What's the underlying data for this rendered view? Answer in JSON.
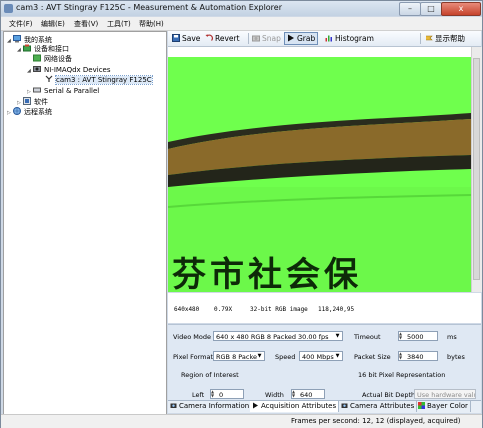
{
  "window": {
    "title": "cam3 : AVT Stingray F125C - Measurement & Automation Explorer",
    "minimize": "–",
    "maximize": "□",
    "close": "x"
  },
  "menubar": [
    "文件(F)",
    "编辑(E)",
    "查看(V)",
    "工具(T)",
    "帮助(H)"
  ],
  "tree": {
    "root": "我的系统",
    "devices_interfaces": "设备和接口",
    "network_devices": "网络设备",
    "imaqdx": "NI-IMAQdx Devices",
    "camera": "cam3 : AVT Stingray F125C",
    "serial": "Serial & Parallel",
    "software": "软件",
    "remote": "远程系统"
  },
  "toolbar": {
    "save": "Save",
    "revert": "Revert",
    "snap": "Snap",
    "grab": "Grab",
    "histogram": "Histogram",
    "help": "显示帮助"
  },
  "image_overlay_text": "芬市社会保",
  "image_info": {
    "resolution": "640x480",
    "zoom": "0.79X",
    "format": "32-bit RGB image",
    "pixel": "118,240,95"
  },
  "attributes": {
    "video_mode_label": "Video Mode",
    "video_mode_value": "640 x 480 RGB 8 Packed 30.00 fps",
    "timeout_label": "Timeout",
    "timeout_value": "5000",
    "timeout_unit": "ms",
    "pixel_format_label": "Pixel Format",
    "pixel_format_value": "RGB 8 Packe",
    "speed_label": "Speed",
    "speed_value": "400 Mbps",
    "packet_size_label": "Packet Size",
    "packet_size_value": "3840",
    "packet_size_unit": "bytes",
    "roi_label": "Region of Interest",
    "bit_repr_label": "16 bit Pixel Representation",
    "left_label": "Left",
    "left_value": "0",
    "width_label": "Width",
    "width_value": "640",
    "actual_bit_depth_label": "Actual Bit Depth",
    "actual_bit_depth_value": "Use hardware value"
  },
  "tabs": [
    "Camera Information",
    "Acquisition Attributes",
    "Camera Attributes",
    "Bayer Color"
  ],
  "status": "Frames per second: 12, 12 (displayed, acquired)",
  "colors": {
    "image_green": "#6fff4d",
    "band_dark": "#2b2a1a",
    "band_brown": "#8a6a2a",
    "accent": "#3a6db5"
  }
}
